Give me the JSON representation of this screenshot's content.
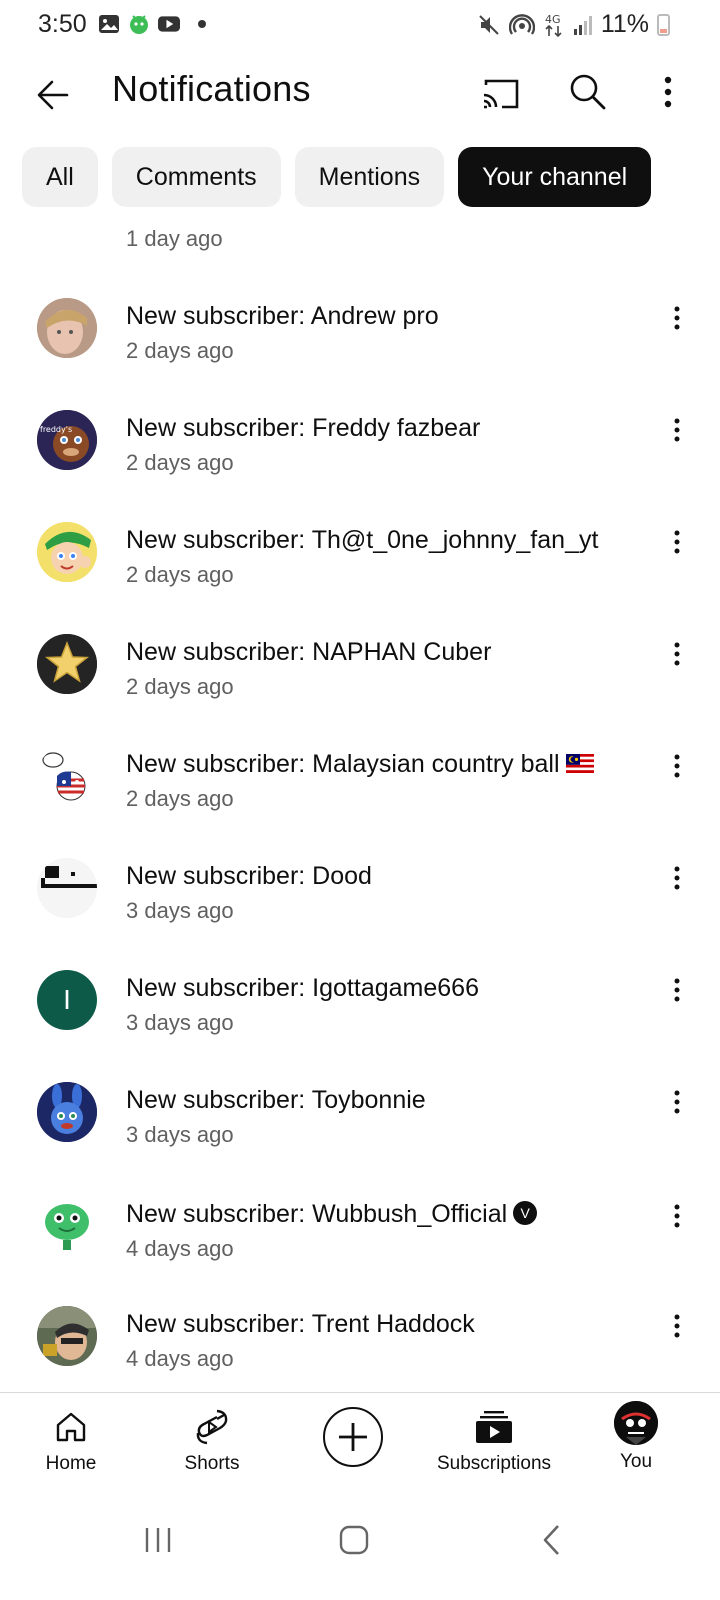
{
  "status_bar": {
    "time": "3:50",
    "battery": "11%",
    "left_icons": [
      "gallery-icon",
      "android-notification-icon",
      "youtube-icon"
    ],
    "right_icons": [
      "mute-icon",
      "hotspot-icon",
      "4g-icon",
      "signal-icon",
      "battery-icon"
    ]
  },
  "header": {
    "title": "Notifications",
    "back_icon": "arrow-left-icon",
    "actions": [
      "cast-icon",
      "search-icon",
      "more-vert-icon"
    ]
  },
  "tabs": [
    {
      "label": "All",
      "active": false
    },
    {
      "label": "Comments",
      "active": false
    },
    {
      "label": "Mentions",
      "active": false
    },
    {
      "label": "Your channel",
      "active": true
    }
  ],
  "notifications": [
    {
      "title": "",
      "time": "1 day ago",
      "avatar": "partial-avatar"
    },
    {
      "title": "New subscriber: Andrew pro",
      "time": "2 days ago",
      "avatar": "andrew-pro-avatar"
    },
    {
      "title": "New subscriber: Freddy fazbear",
      "time": "2 days ago",
      "avatar": "freddy-avatar"
    },
    {
      "title": "New subscriber: Th@t_0ne_johnny_fan_yt",
      "time": "2 days ago",
      "avatar": "cartoon-avatar"
    },
    {
      "title": "New subscriber: NAPHAN Cuber",
      "time": "2 days ago",
      "avatar": "star-avatar"
    },
    {
      "title": "New subscriber: Malaysian country ball",
      "time": "2 days ago",
      "avatar": "countryball-avatar",
      "badge": "malaysia-flag"
    },
    {
      "title": "New subscriber: Dood",
      "time": "3 days ago",
      "avatar": "dood-avatar"
    },
    {
      "title": "New subscriber: Igottagame666",
      "time": "3 days ago",
      "avatar": "letter-avatar",
      "avatar_letter": "I",
      "avatar_color": "#0d5a48"
    },
    {
      "title": "New subscriber: Toybonnie",
      "time": "3 days ago",
      "avatar": "toybonnie-avatar"
    },
    {
      "title": "New subscriber: Wubbush_Official",
      "time": "4 days ago",
      "avatar": "wubbush-avatar",
      "badge": "verified",
      "badge_letter": "V"
    },
    {
      "title": "New subscriber: Trent Haddock",
      "time": "4 days ago",
      "avatar": "trent-avatar"
    }
  ],
  "bottom_nav": [
    {
      "label": "Home",
      "icon": "home-icon"
    },
    {
      "label": "Shorts",
      "icon": "shorts-icon"
    },
    {
      "label": "",
      "icon": "create-icon"
    },
    {
      "label": "Subscriptions",
      "icon": "subscriptions-icon"
    },
    {
      "label": "You",
      "icon": "profile-avatar"
    }
  ],
  "system_nav": [
    "recents-icon",
    "home-icon",
    "back-icon"
  ],
  "colors": {
    "text_primary": "#0f0f0f",
    "text_secondary": "#606060",
    "chip_bg": "#f0f0f0",
    "chip_active_bg": "#0f0f0f"
  }
}
